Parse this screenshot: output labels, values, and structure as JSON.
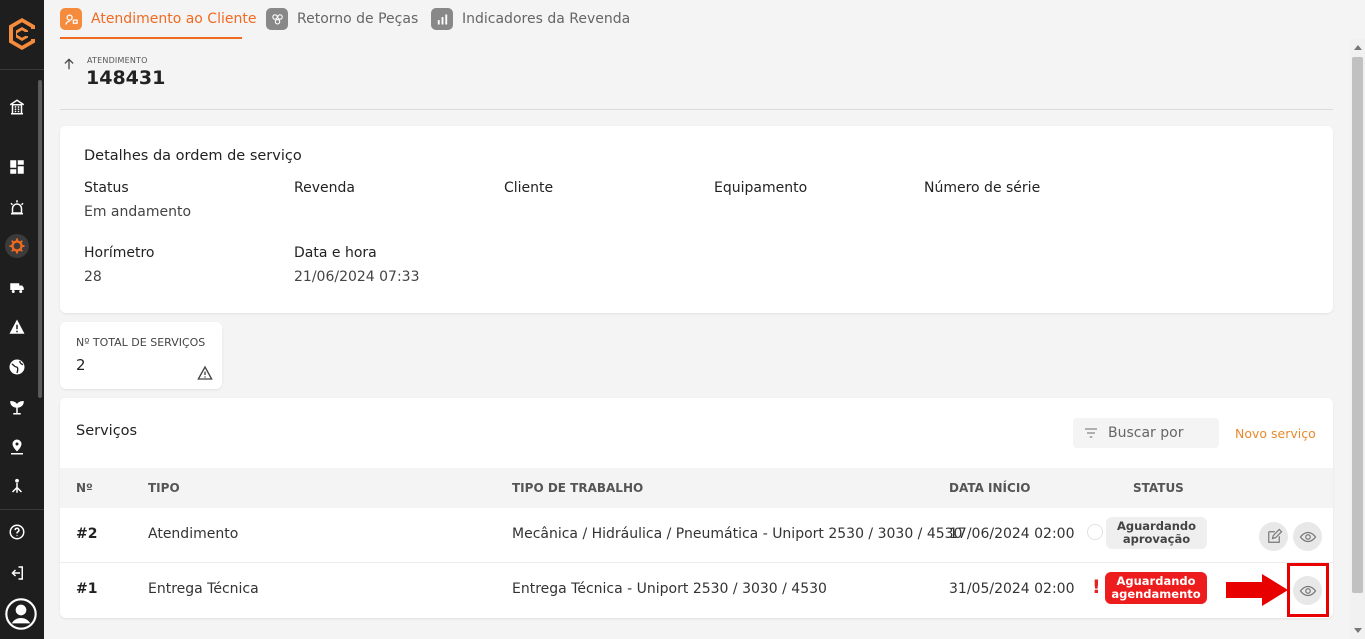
{
  "tabs": [
    {
      "label": "Atendimento ao Cliente",
      "active": true
    },
    {
      "label": "Retorno de Peças",
      "active": false
    },
    {
      "label": "Indicadores da Revenda",
      "active": false
    }
  ],
  "header": {
    "label": "ATENDIMENTO",
    "number": "148431"
  },
  "details": {
    "title": "Detalhes da ordem de serviço",
    "status_label": "Status",
    "status_value": "Em andamento",
    "revenda_label": "Revenda",
    "cliente_label": "Cliente",
    "equipamento_label": "Equipamento",
    "serie_label": "Número de série",
    "horimetro_label": "Horímetro",
    "horimetro_value": "28",
    "data_label": "Data e hora",
    "data_value": "21/06/2024 07:33"
  },
  "total": {
    "label": "Nº TOTAL DE SERVIÇOS",
    "value": "2"
  },
  "services": {
    "title": "Serviços",
    "search_placeholder": "Buscar por",
    "new_label": "Novo serviço",
    "columns": {
      "num": "Nº",
      "tipo": "TIPO",
      "trabalho": "TIPO DE TRABALHO",
      "data": "DATA INÍCIO",
      "status": "STATUS"
    },
    "rows": [
      {
        "num": "#2",
        "tipo": "Atendimento",
        "trabalho": "Mecânica / Hidráulica / Pneumática - Uniport 2530 / 3030 / 4530",
        "data": "17/06/2024 02:00",
        "status_line1": "Aguardando",
        "status_line2": "aprovação"
      },
      {
        "num": "#1",
        "tipo": "Entrega Técnica",
        "trabalho": "Entrega Técnica - Uniport 2530 / 3030 / 4530",
        "data": "31/05/2024 02:00",
        "alert": "!",
        "status_line1": "Aguardando",
        "status_line2": "agendamento"
      }
    ]
  },
  "colors": {
    "accent": "#f06a22",
    "status_red": "#ee1d1d",
    "sidebar": "#1e1e1e",
    "highlight": "#e80000"
  },
  "icons": {
    "sidebar": [
      "logo-icon",
      "building-icon",
      "dashboard-icon",
      "alarm-icon",
      "service-gear-icon",
      "truck-icon",
      "warning-icon",
      "globe-icon",
      "plant-icon",
      "location-icon",
      "network-icon",
      "help-icon",
      "logout-icon",
      "user-avatar-icon"
    ],
    "row_actions": [
      "edit-icon",
      "eye-icon"
    ]
  }
}
